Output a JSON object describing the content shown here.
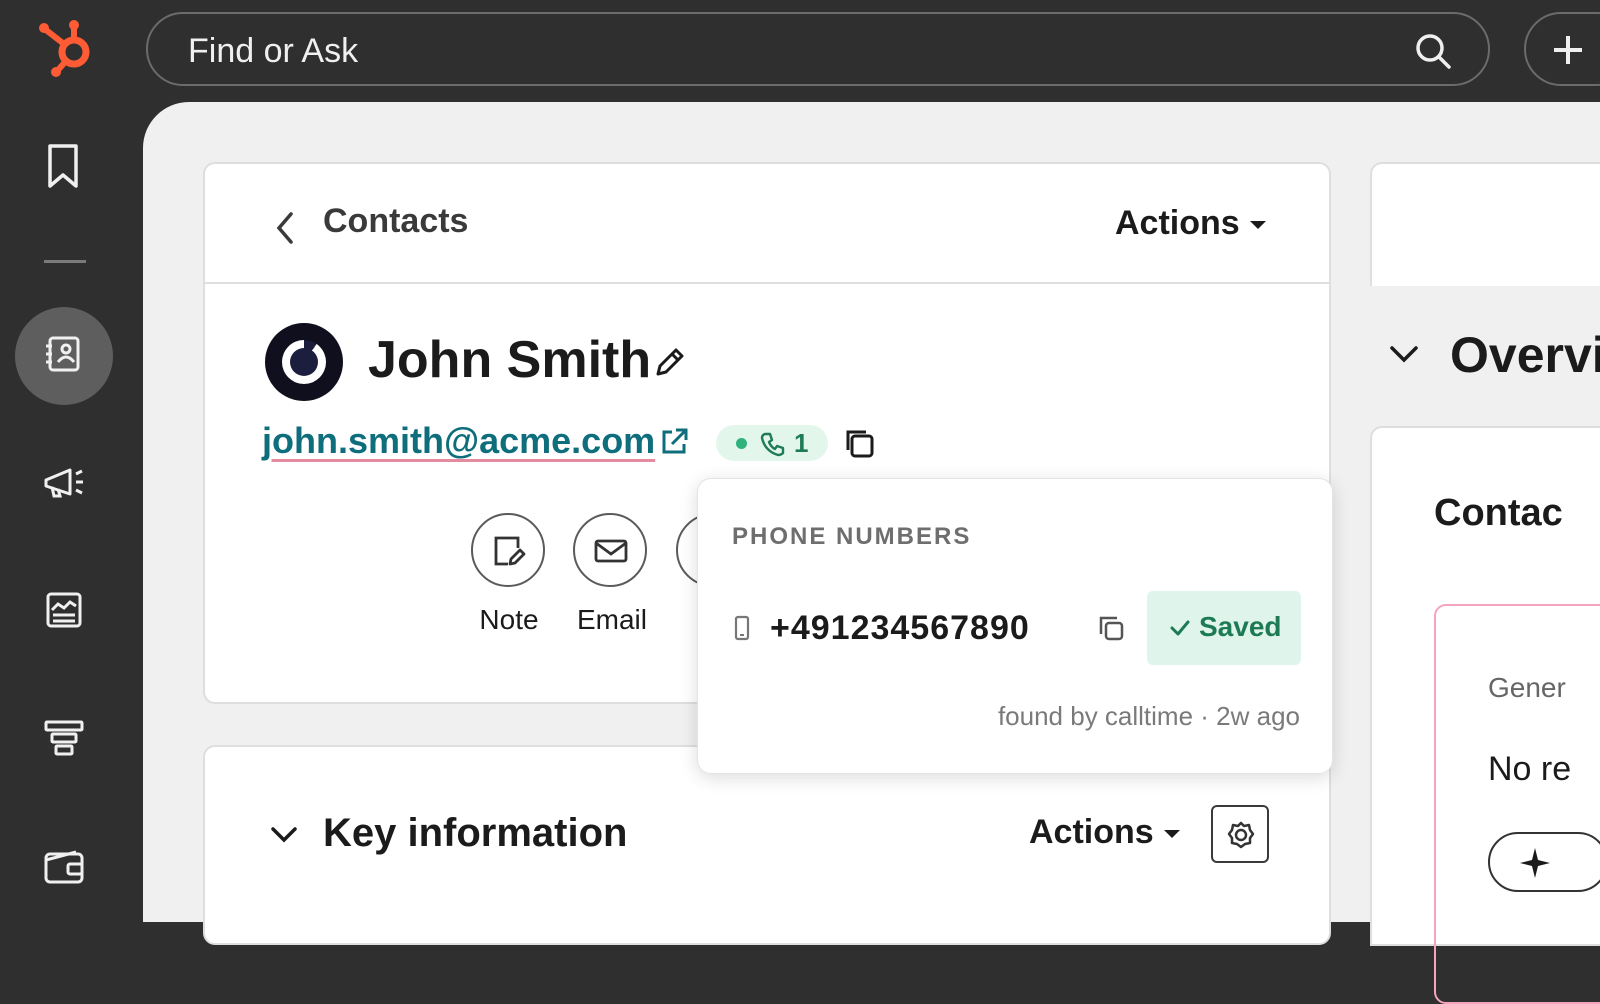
{
  "search": {
    "placeholder": "Find or Ask"
  },
  "header": {
    "breadcrumb": "Contacts",
    "actions_label": "Actions"
  },
  "contact": {
    "name": "John Smith",
    "email": "john.smith@acme.com",
    "phone_count": "1"
  },
  "quick_actions": [
    {
      "label": "Note",
      "icon": "note-icon"
    },
    {
      "label": "Email",
      "icon": "mail-icon"
    }
  ],
  "key_info": {
    "title": "Key information",
    "actions_label": "Actions"
  },
  "overview": {
    "title": "Overview"
  },
  "right_panel": {
    "title": "Contac",
    "general_label": "Gener",
    "no_records": "No re"
  },
  "phone_popup": {
    "title": "PHONE NUMBERS",
    "number": "+491234567890",
    "saved_label": "Saved",
    "found_by": "found by calltime · 2w ago"
  },
  "colors": {
    "brand": "#ff5c35",
    "sidebar_bg": "#2f2f2f",
    "email_link": "#0f6e7c",
    "success": "#1d7a55"
  }
}
